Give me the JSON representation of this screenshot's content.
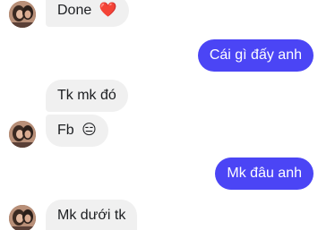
{
  "messages": [
    {
      "id": "m1",
      "direction": "incoming",
      "text": "Done",
      "emoji": "❤️",
      "emoji_name": "red-heart"
    },
    {
      "id": "m2",
      "direction": "outgoing",
      "text": "Cái gì đấy anh"
    },
    {
      "id": "m3",
      "direction": "incoming",
      "text": "Tk mk đó"
    },
    {
      "id": "m4",
      "direction": "incoming",
      "text": "Fb",
      "emoji": "😑",
      "emoji_name": "expressionless-face"
    },
    {
      "id": "m5",
      "direction": "outgoing",
      "text": "Mk đâu anh"
    },
    {
      "id": "m6",
      "direction": "incoming",
      "text": "Mk dưới tk"
    }
  ],
  "colors": {
    "outgoing_bubble": "#4b45f5",
    "incoming_bubble": "#f0f0f0",
    "background": "#ffffff"
  }
}
